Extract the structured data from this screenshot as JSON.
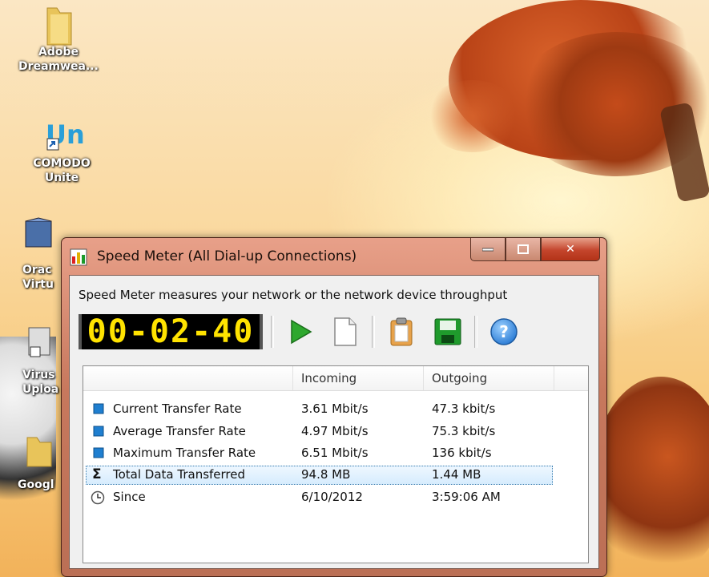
{
  "desktop": {
    "icons": [
      {
        "line1": "Adobe",
        "line2": "Dreamwea..."
      },
      {
        "line1": "COMODO",
        "line2": "Unite"
      },
      {
        "line1": "Orac",
        "line2": "Virtu"
      },
      {
        "line1": "Virus",
        "line2": "Uploa"
      },
      {
        "line1": "Googl",
        "line2": ""
      }
    ]
  },
  "window": {
    "title": "Speed Meter (All Dial-up Connections)",
    "caption_buttons": {
      "minimize": "",
      "maximize": "",
      "close": "✕"
    },
    "description": "Speed Meter measures your network or the network device throughput",
    "timer": "00-02-40",
    "toolbar": {
      "icons": [
        "play-icon",
        "new-page-icon",
        "clipboard-icon",
        "save-icon",
        "help-icon"
      ],
      "help_glyph": "?"
    },
    "table": {
      "columns": [
        "",
        "Incoming",
        "Outgoing"
      ],
      "rows": [
        {
          "label": "Current Transfer Rate",
          "incoming": "3.61 Mbit/s",
          "outgoing": "47.3 kbit/s",
          "icon": "blue-square-icon"
        },
        {
          "label": "Average Transfer Rate",
          "incoming": "4.97 Mbit/s",
          "outgoing": "75.3 kbit/s",
          "icon": "blue-square-icon"
        },
        {
          "label": "Maximum Transfer Rate",
          "incoming": "6.51 Mbit/s",
          "outgoing": "136 kbit/s",
          "icon": "blue-square-icon"
        },
        {
          "label": "Total Data Transferred",
          "incoming": "94.8 MB",
          "outgoing": "1.44 MB",
          "icon": "sigma-icon",
          "glyph": "Σ",
          "selected": true
        },
        {
          "label": "Since",
          "incoming": "6/10/2012",
          "outgoing": "3:59:06 AM",
          "icon": "clock-icon"
        }
      ]
    }
  },
  "colors": {
    "timer_digits": "#ffe300",
    "play_green": "#2ea82e",
    "save_green": "#1f9a2c",
    "help_blue": "#2f7fd6",
    "row_icon_blue": "#1f7fd0",
    "selection": "#d6ecfd"
  }
}
